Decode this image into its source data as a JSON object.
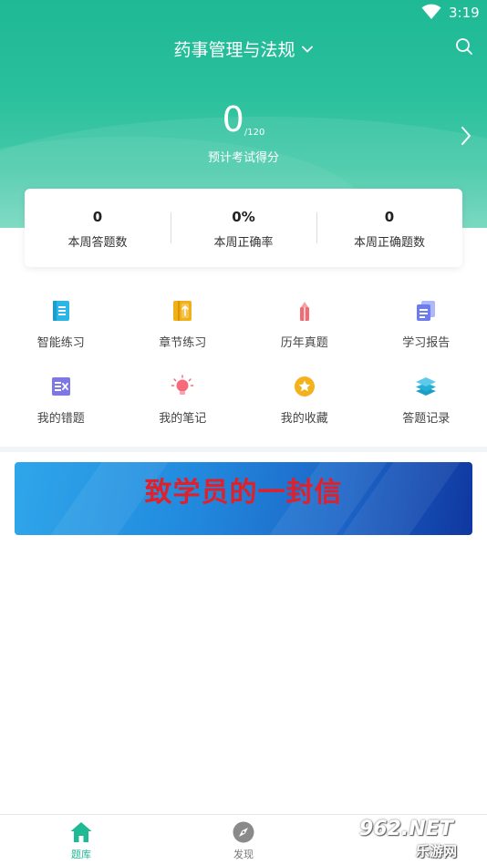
{
  "status_bar": {
    "time": "3:19"
  },
  "header": {
    "subject": "药事管理与法规"
  },
  "score": {
    "value": "0",
    "max": "/120",
    "label": "预计考试得分"
  },
  "stats": [
    {
      "value": "0",
      "label": "本周答题数"
    },
    {
      "value": "0%",
      "label": "本周正确率"
    },
    {
      "value": "0",
      "label": "本周正确题数"
    }
  ],
  "grid": [
    {
      "label": "智能练习",
      "icon": "book-icon",
      "color": "#2bb7e6"
    },
    {
      "label": "章节练习",
      "icon": "chapter-book-icon",
      "color": "#f2b018"
    },
    {
      "label": "历年真题",
      "icon": "pencil-icon",
      "color": "#f26a73"
    },
    {
      "label": "学习报告",
      "icon": "report-icon",
      "color": "#6c7cf0"
    },
    {
      "label": "我的错题",
      "icon": "wrong-questions-icon",
      "color": "#7d78e6"
    },
    {
      "label": "我的笔记",
      "icon": "lightbulb-icon",
      "color": "#f46a7b"
    },
    {
      "label": "我的收藏",
      "icon": "star-icon",
      "color": "#f3b21c"
    },
    {
      "label": "答题记录",
      "icon": "layers-icon",
      "color": "#2cb8df"
    }
  ],
  "banner": {
    "text": "致学员的一封信"
  },
  "bottom_nav": [
    {
      "label": "题库",
      "icon": "home-icon",
      "active": true
    },
    {
      "label": "发现",
      "icon": "compass-icon",
      "active": false
    }
  ],
  "watermark": {
    "top": "962.NET",
    "bottom": "乐游网"
  },
  "colors": {
    "primary": "#1fb995",
    "banner_text": "#e0202a"
  }
}
